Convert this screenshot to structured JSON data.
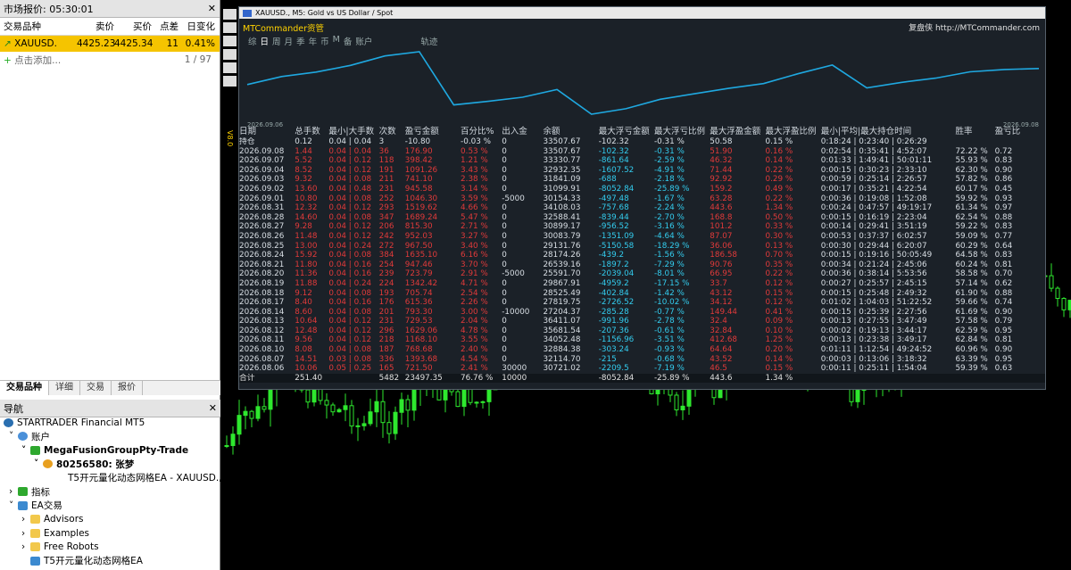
{
  "market_watch": {
    "title": "市场报价: 05:30:01",
    "close": "✕",
    "headers": [
      "交易品种",
      "卖价",
      "买价",
      "点差",
      "日变化"
    ],
    "rows": [
      {
        "symbol": "XAUUSD.",
        "bid": "4425.23",
        "ask": "4425.34",
        "spread": "11",
        "change": "0.41%"
      }
    ],
    "add_label": "点击添加...",
    "count": "1 / 97",
    "tabs": [
      "交易品种",
      "详细",
      "交易",
      "报价"
    ]
  },
  "navigator": {
    "title": "导航",
    "close": "✕",
    "items": [
      "STARTRADER Financial MT5",
      "账户",
      "MegaFusionGroupPty-Trade",
      "80256580: 张梦",
      "T5开元量化动态网格EA - XAUUSD.,M",
      "指标",
      "EA交易",
      "Advisors",
      "Examples",
      "Free Robots",
      "T5开元量化动态网格EA"
    ]
  },
  "chart": {
    "title": "XAUUSD., M5:  Gold vs US Dollar / Spot",
    "brand": "MTCommander资管",
    "brand_right": "复盘侠  http://MTCommander.com",
    "menu": [
      "综",
      "日",
      "周",
      "月",
      "季",
      "年",
      "币",
      "M",
      "备",
      "账户"
    ],
    "track": "轨迹",
    "date_start": "2026.09.06",
    "date_end": "2026.09.08",
    "yaxis": "V8.0"
  },
  "colors": {
    "curve": "#1fa8e0",
    "loss": "#e03a3a",
    "accent": "#33ccee"
  },
  "table": {
    "headers": [
      "日期",
      "总手数",
      "最小|大手数",
      "次数",
      "盈亏金额",
      "百分比%",
      "出入金",
      "余额",
      "最大浮亏金额",
      "最大浮亏比例",
      "最大浮盈金额",
      "最大浮盈比例",
      "最小|平均|最大持仓时间",
      "",
      "胜率",
      "盈亏比"
    ],
    "holding": [
      "持仓",
      "0.12",
      "0.04 | 0.04",
      "3",
      "-10.80",
      "-0.03 %",
      "0",
      "33507.67",
      "-102.32",
      "-0.31 %",
      "50.58",
      "0.15 %",
      "0:18:24 | 0:23:40 | 0:26:29",
      "",
      "",
      ""
    ],
    "rows": [
      [
        "2026.09.08",
        "1.44",
        "0.04 | 0.04",
        "36",
        "176.90",
        "0.53 %",
        "0",
        "33507.67",
        "-102.32",
        "-0.31 %",
        "51.90",
        "0.16 %",
        "0:02:54 | 0:35:41 | 4:52:07",
        "",
        "72.22 %",
        "0.72"
      ],
      [
        "2026.09.07",
        "5.52",
        "0.04 | 0.12",
        "118",
        "398.42",
        "1.21 %",
        "0",
        "33330.77",
        "-861.64",
        "-2.59 %",
        "46.32",
        "0.14 %",
        "0:01:33 | 1:49:41 | 50:01:11",
        "",
        "55.93 %",
        "0.83"
      ],
      [
        "2026.09.04",
        "8.52",
        "0.04 | 0.12",
        "191",
        "1091.26",
        "3.43 %",
        "0",
        "32932.35",
        "-1607.52",
        "-4.91 %",
        "71.44",
        "0.22 %",
        "0:00:15 | 0:30:23 | 2:33:10",
        "",
        "62.30 %",
        "0.90"
      ],
      [
        "2026.09.03",
        "9.32",
        "0.04 | 0.08",
        "211",
        "741.10",
        "2.38 %",
        "0",
        "31841.09",
        "-688",
        "-2.18 %",
        "92.92",
        "0.29 %",
        "0:00:59 | 0:25:14 | 2:26:57",
        "",
        "57.82 %",
        "0.86"
      ],
      [
        "2026.09.02",
        "13.60",
        "0.04 | 0.48",
        "231",
        "945.58",
        "3.14 %",
        "0",
        "31099.91",
        "-8052.84",
        "-25.89 %",
        "159.2",
        "0.49 %",
        "0:00:17 | 0:35:21 | 4:22:54",
        "",
        "60.17 %",
        "0.45"
      ],
      [
        "2026.09.01",
        "10.80",
        "0.04 | 0.08",
        "252",
        "1046.30",
        "3.59 %",
        "-5000",
        "30154.33",
        "-497.48",
        "-1.67 %",
        "63.28",
        "0.22 %",
        "0:00:36 | 0:19:08 | 1:52:08",
        "",
        "59.92 %",
        "0.93"
      ],
      [
        "2026.08.31",
        "12.32",
        "0.04 | 0.12",
        "293",
        "1519.62",
        "4.66 %",
        "0",
        "34108.03",
        "-757.68",
        "-2.24 %",
        "443.6",
        "1.34 %",
        "0:00:24 | 0:47:57 | 49:19:17",
        "",
        "61.34 %",
        "0.97"
      ],
      [
        "2026.08.28",
        "14.60",
        "0.04 | 0.08",
        "347",
        "1689.24",
        "5.47 %",
        "0",
        "32588.41",
        "-839.44",
        "-2.70 %",
        "168.8",
        "0.50 %",
        "0:00:15 | 0:16:19 | 2:23:04",
        "",
        "62.54 %",
        "0.88"
      ],
      [
        "2026.08.27",
        "9.28",
        "0.04 | 0.12",
        "206",
        "815.30",
        "2.71 %",
        "0",
        "30899.17",
        "-956.52",
        "-3.16 %",
        "101.2",
        "0.33 %",
        "0:00:14 | 0:29:41 | 3:51:19",
        "",
        "59.22 %",
        "0.83"
      ],
      [
        "2026.08.26",
        "11.48",
        "0.04 | 0.12",
        "242",
        "952.03",
        "3.27 %",
        "0",
        "30083.79",
        "-1351.09",
        "-4.64 %",
        "87.07",
        "0.30 %",
        "0:00:53 | 0:37:37 | 6:02:57",
        "",
        "59.09 %",
        "0.77"
      ],
      [
        "2026.08.25",
        "13.00",
        "0.04 | 0.24",
        "272",
        "967.50",
        "3.40 %",
        "0",
        "29131.76",
        "-5150.58",
        "-18.29 %",
        "36.06",
        "0.13 %",
        "0:00:30 | 0:29:44 | 6:20:07",
        "",
        "60.29 %",
        "0.64"
      ],
      [
        "2026.08.24",
        "15.92",
        "0.04 | 0.08",
        "384",
        "1635.10",
        "6.16 %",
        "0",
        "28174.26",
        "-439.2",
        "-1.56 %",
        "186.58",
        "0.70 %",
        "0:00:15 | 0:19:16 | 50:05:49",
        "",
        "64.58 %",
        "0.83"
      ],
      [
        "2026.08.21",
        "11.80",
        "0.04 | 0.16",
        "254",
        "947.46",
        "3.70 %",
        "0",
        "26539.16",
        "-1897.2",
        "-7.29 %",
        "90.76",
        "0.35 %",
        "0:00:34 | 0:21:24 | 2:45:06",
        "",
        "60.24 %",
        "0.81"
      ],
      [
        "2026.08.20",
        "11.36",
        "0.04 | 0.16",
        "239",
        "723.79",
        "2.91 %",
        "-5000",
        "25591.70",
        "-2039.04",
        "-8.01 %",
        "66.95",
        "0.22 %",
        "0:00:36 | 0:38:14 | 5:53:56",
        "",
        "58.58 %",
        "0.70"
      ],
      [
        "2026.08.19",
        "11.88",
        "0.04 | 0.24",
        "224",
        "1342.42",
        "4.71 %",
        "0",
        "29867.91",
        "-4959.2",
        "-17.15 %",
        "33.7",
        "0.12 %",
        "0:00:27 | 0:25:57 | 2:45:15",
        "",
        "57.14 %",
        "0.62"
      ],
      [
        "2026.08.18",
        "9.12",
        "0.04 | 0.08",
        "193",
        "705.74",
        "2.54 %",
        "0",
        "28525.49",
        "-402.84",
        "-1.42 %",
        "43.12",
        "0.15 %",
        "0:00:15 | 0:25:48 | 2:49:32",
        "",
        "61.90 %",
        "0.88"
      ],
      [
        "2026.08.17",
        "8.40",
        "0.04 | 0.16",
        "176",
        "615.36",
        "2.26 %",
        "0",
        "27819.75",
        "-2726.52",
        "-10.02 %",
        "34.12",
        "0.12 %",
        "0:01:02 | 1:04:03 | 51:22:52",
        "",
        "59.66 %",
        "0.74"
      ],
      [
        "2026.08.14",
        "8.60",
        "0.04 | 0.08",
        "201",
        "793.30",
        "3.00 %",
        "-10000",
        "27204.37",
        "-285.28",
        "-0.77 %",
        "149.44",
        "0.41 %",
        "0:00:15 | 0:25:39 | 2:27:56",
        "",
        "61.69 %",
        "0.90"
      ],
      [
        "2026.08.13",
        "10.64",
        "0.04 | 0.12",
        "231",
        "729.53",
        "2.04 %",
        "0",
        "36411.07",
        "-991.96",
        "-2.78 %",
        "32.4",
        "0.09 %",
        "0:00:13 | 0:27:55 | 3:47:49",
        "",
        "57.58 %",
        "0.79"
      ],
      [
        "2026.08.12",
        "12.48",
        "0.04 | 0.12",
        "296",
        "1629.06",
        "4.78 %",
        "0",
        "35681.54",
        "-207.36",
        "-0.61 %",
        "32.84",
        "0.10 %",
        "0:00:02 | 0:19:13 | 3:44:17",
        "",
        "62.59 %",
        "0.95"
      ],
      [
        "2026.08.11",
        "9.56",
        "0.04 | 0.12",
        "218",
        "1168.10",
        "3.55 %",
        "0",
        "34052.48",
        "-1156.96",
        "-3.51 %",
        "412.68",
        "1.25 %",
        "0:00:13 | 0:23:38 | 3:49:17",
        "",
        "62.84 %",
        "0.81"
      ],
      [
        "2026.08.10",
        "8.08",
        "0.04 | 0.08",
        "187",
        "768.68",
        "2.40 %",
        "0",
        "32884.38",
        "-303.24",
        "-0.93 %",
        "64.64",
        "0.20 %",
        "0:01:11 | 1:12:54 | 49:24:52",
        "",
        "60.96 %",
        "0.90"
      ],
      [
        "2026.08.07",
        "14.51",
        "0.03 | 0.08",
        "336",
        "1393.68",
        "4.54 %",
        "0",
        "32114.70",
        "-215",
        "-0.68 %",
        "43.52",
        "0.14 %",
        "0:00:03 | 0:13:06 | 3:18:32",
        "",
        "63.39 %",
        "0.95"
      ],
      [
        "2026.08.06",
        "10.06",
        "0.05 | 0.25",
        "165",
        "721.50",
        "2.41 %",
        "30000",
        "30721.02",
        "-2209.5",
        "-7.19 %",
        "46.5",
        "0.15 %",
        "0:00:11 | 0:25:11 | 1:54:04",
        "",
        "59.39 %",
        "0.63"
      ]
    ],
    "total": [
      "合计",
      "251.40",
      "",
      "5482",
      "23497.35",
      "76.76 %",
      "10000",
      "",
      "-8052.84",
      "-25.89 %",
      "443.6",
      "1.34 %",
      "",
      "",
      "",
      ""
    ]
  }
}
